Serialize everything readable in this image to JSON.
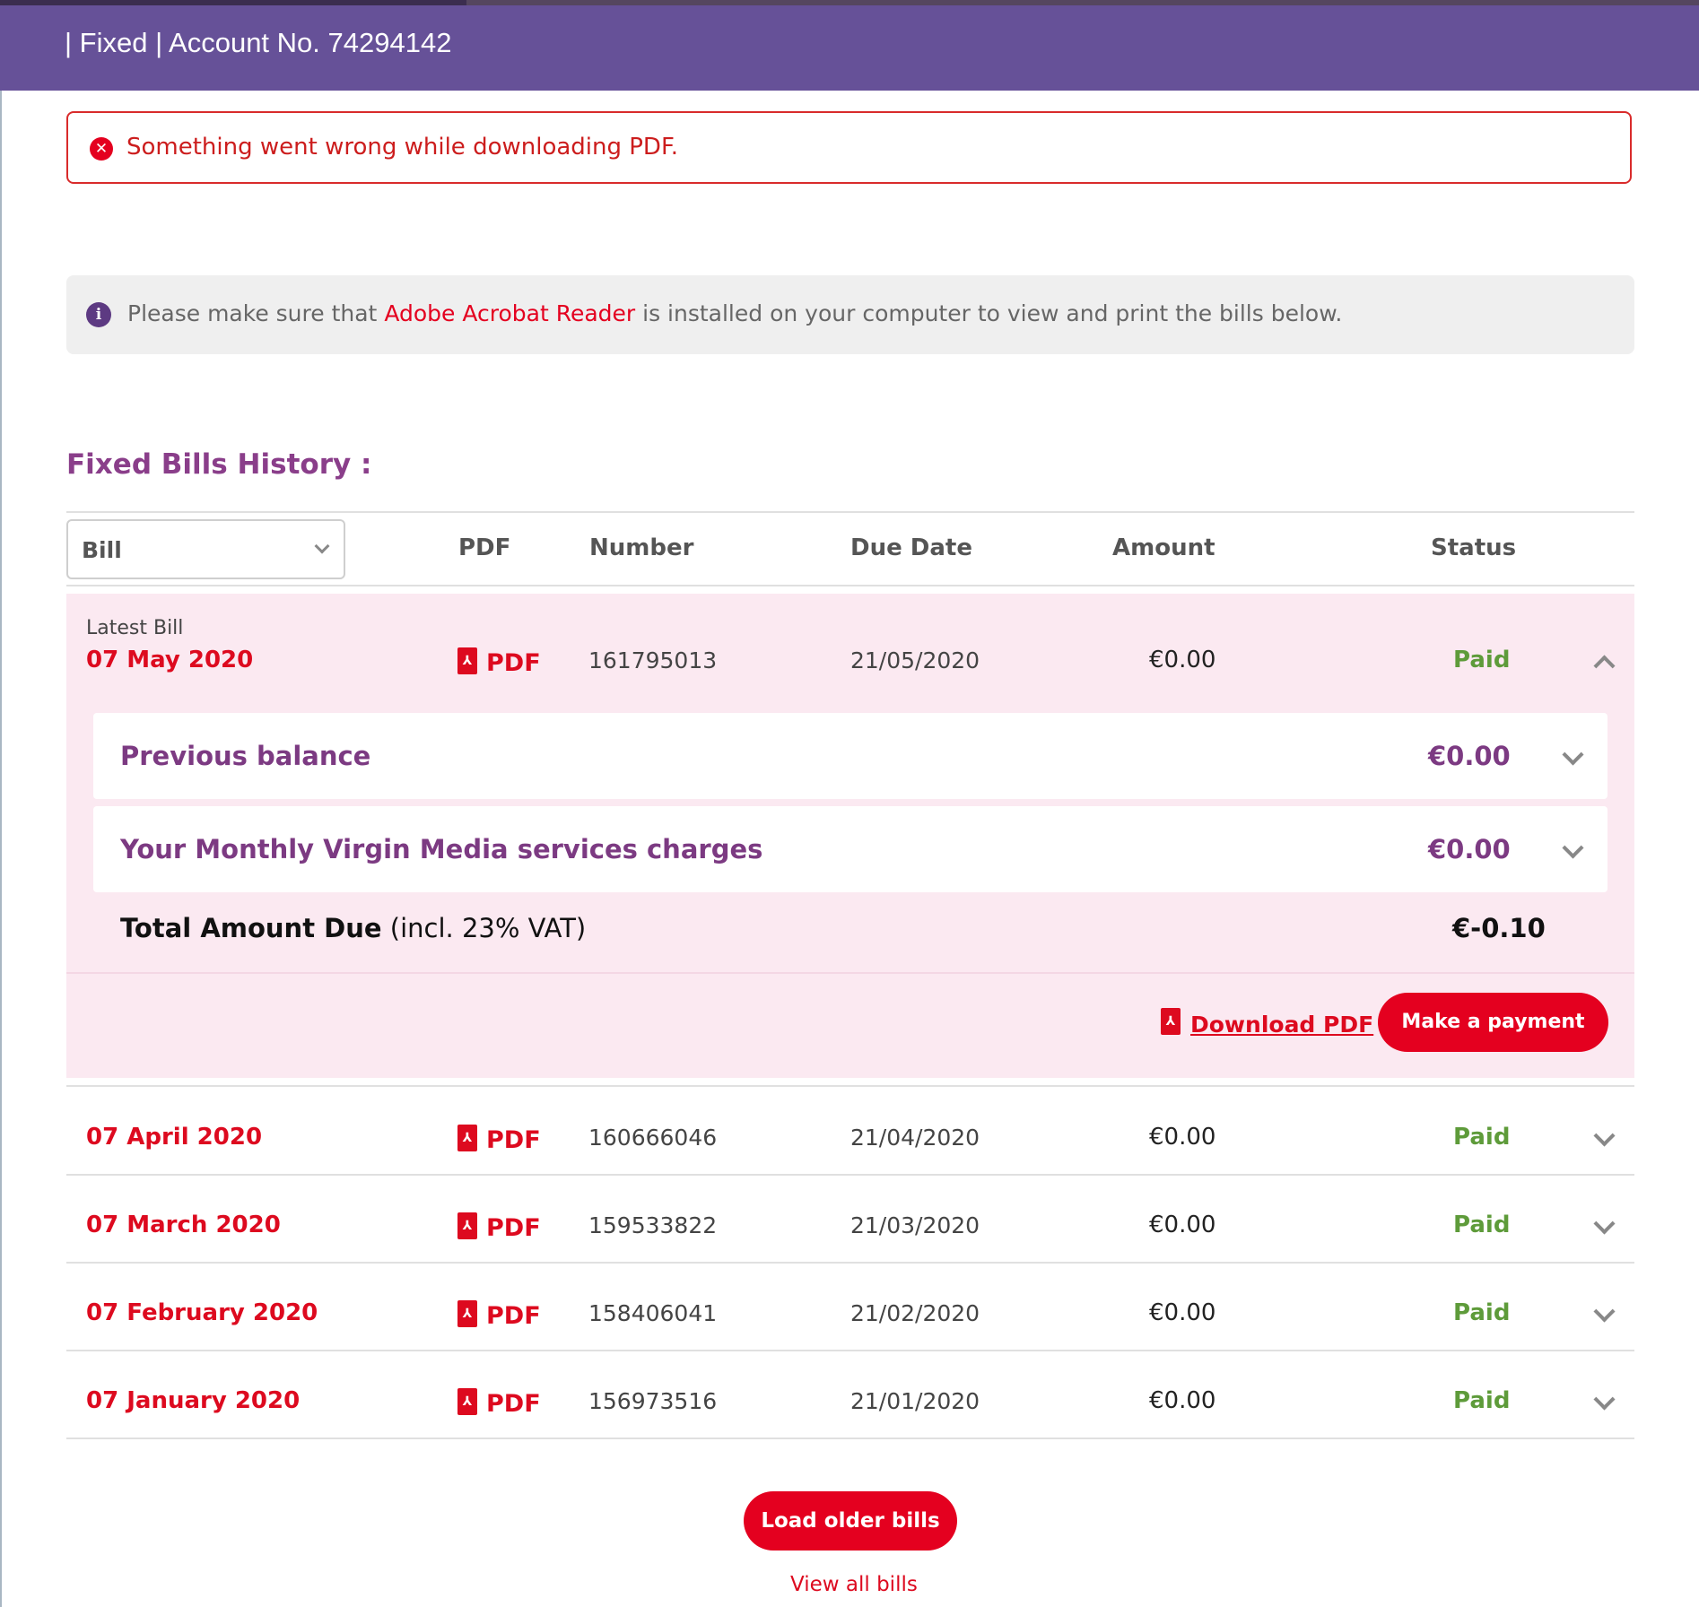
{
  "header": {
    "account_text": "| Fixed | Account No. 74294142"
  },
  "error_alert": {
    "message": "Something went wrong while downloading PDF.",
    "icon": "x-circle-icon"
  },
  "info_banner": {
    "text_before": "Please make sure that ",
    "link_text": "Adobe Acrobat Reader",
    "text_after": " is installed on your computer to view and print the bills below.",
    "icon": "info-icon"
  },
  "section_title": "Fixed Bills History :",
  "table": {
    "select_value": "Bill",
    "headers": {
      "pdf": "PDF",
      "number": "Number",
      "due_date": "Due Date",
      "amount": "Amount",
      "status": "Status"
    }
  },
  "latest_bill": {
    "label": "Latest Bill",
    "date": "07 May 2020",
    "pdf": "PDF",
    "number": "161795013",
    "due_date": "21/05/2020",
    "amount": "€0.00",
    "status": "Paid",
    "details": [
      {
        "label": "Previous balance",
        "amount": "€0.00"
      },
      {
        "label": "Your Monthly Virgin Media services charges",
        "amount": "€0.00"
      }
    ],
    "total_label": "Total Amount Due",
    "total_note": " (incl. 23% VAT)",
    "total_amount": "€-0.10",
    "download_label": "Download PDF",
    "pay_label": "Make a payment"
  },
  "bills": [
    {
      "date": "07 April 2020",
      "pdf": "PDF",
      "number": "160666046",
      "due_date": "21/04/2020",
      "amount": "€0.00",
      "status": "Paid"
    },
    {
      "date": "07 March 2020",
      "pdf": "PDF",
      "number": "159533822",
      "due_date": "21/03/2020",
      "amount": "€0.00",
      "status": "Paid"
    },
    {
      "date": "07 February 2020",
      "pdf": "PDF",
      "number": "158406041",
      "due_date": "21/02/2020",
      "amount": "€0.00",
      "status": "Paid"
    },
    {
      "date": "07 January 2020",
      "pdf": "PDF",
      "number": "156973516",
      "due_date": "21/01/2020",
      "amount": "€0.00",
      "status": "Paid"
    }
  ],
  "load_older_label": "Load older bills",
  "view_all_label": "View all bills",
  "colors": {
    "header_purple": "#665198",
    "brand_red": "#e4001f",
    "paid_green": "#5e9b3a",
    "section_purple": "#8a3e8a",
    "latest_bg": "#fbe9f1"
  }
}
